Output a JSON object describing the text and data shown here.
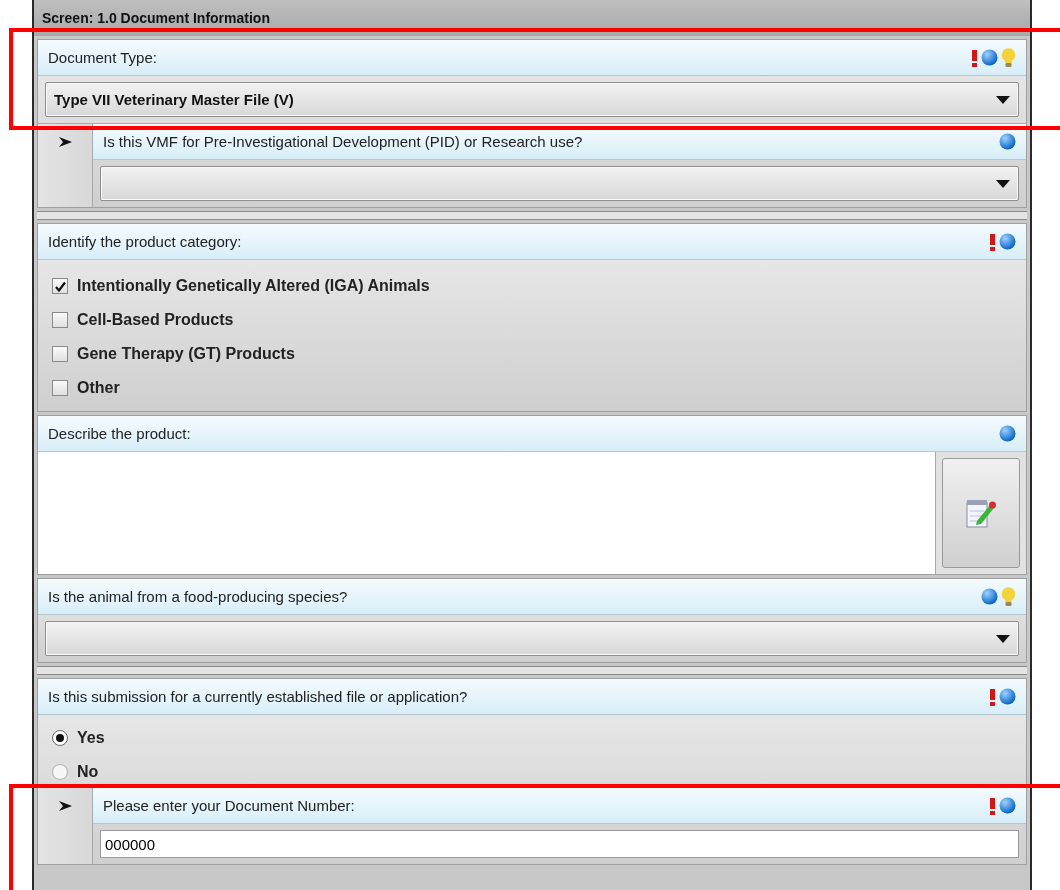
{
  "screen_title": "Screen: 1.0 Document Information",
  "groups": [
    [
      {
        "kind": "dropdown",
        "label": "Document Type:",
        "required": true,
        "info": true,
        "hint": true,
        "value": "Type VII Veterinary Master File (V)",
        "sub": {
          "kind": "dropdown",
          "label": "Is this VMF for Pre-Investigational Development (PID) or Research use?",
          "required": false,
          "info": true,
          "hint": false
        }
      }
    ],
    [
      {
        "kind": "checkboxes",
        "label": "Identify the product category:",
        "required": true,
        "info": true,
        "hint": false,
        "options": [
          {
            "label": "Intentionally Genetically Altered (IGA) Animals",
            "checked": true
          },
          {
            "label": "Cell-Based Products",
            "checked": false
          },
          {
            "label": "Gene Therapy (GT) Products",
            "checked": false
          },
          {
            "label": "Other",
            "checked": false
          }
        ]
      },
      {
        "kind": "text_area",
        "label": "Describe the product:",
        "required": false,
        "info": true,
        "hint": false
      },
      {
        "kind": "dropdown",
        "label": "Is the animal from a food-producing species?",
        "required": false,
        "info": true,
        "hint": true
      }
    ],
    [
      {
        "kind": "radios",
        "label": "Is this submission for a currently established file or application?",
        "required": true,
        "info": true,
        "hint": false,
        "options": [
          {
            "label": "Yes",
            "selected": true
          },
          {
            "label": "No",
            "selected": false
          }
        ],
        "sub": {
          "kind": "text_field",
          "label": "Please enter your Document Number:",
          "required": true,
          "info": true,
          "hint": false,
          "value": "000000"
        }
      }
    ]
  ]
}
